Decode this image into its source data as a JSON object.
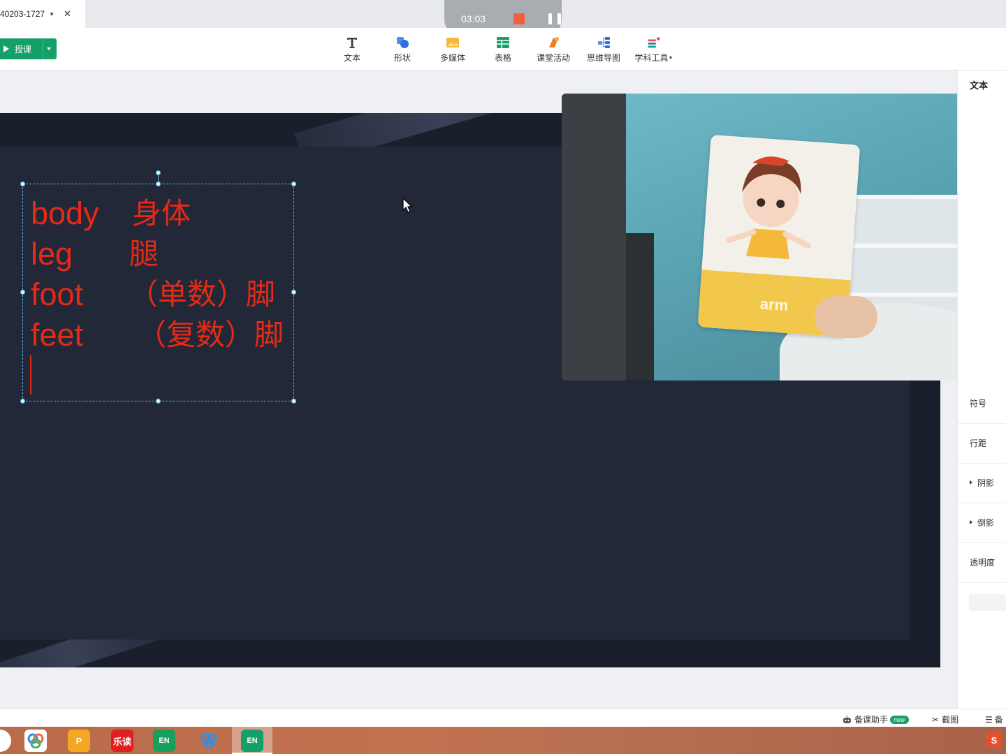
{
  "tab": {
    "title": "40203-1727",
    "close": "✕"
  },
  "recorder": {
    "time": "03:03"
  },
  "toolbar": {
    "teach_label": "授课",
    "tools": {
      "text": "文本",
      "shape": "形状",
      "media": "多媒体",
      "table": "表格",
      "activity": "课堂活动",
      "mindmap": "思维导图",
      "subject": "学科工具"
    }
  },
  "slide": {
    "lines": [
      {
        "en": "body",
        "zh": "身体"
      },
      {
        "en": "leg",
        "zh": "腿"
      },
      {
        "en": "foot",
        "zh": "（单数）脚"
      },
      {
        "en": "feet",
        "zh": "（复数）脚"
      }
    ],
    "text_color": "#e52a16",
    "background": "#222838"
  },
  "camera": {
    "card_word": "arm"
  },
  "props": {
    "title": "文本",
    "symbol": "符号",
    "line_spacing": "行距",
    "shadow": "阴影",
    "reflection": "倒影",
    "opacity": "透明度"
  },
  "statusbar": {
    "assistant": "备课助手",
    "assistant_badge": "new",
    "screenshot": "截图",
    "notes": "备"
  },
  "taskbar": {
    "apps": [
      "乐读",
      "EN",
      "EN"
    ],
    "tray": "S"
  },
  "colors": {
    "accent": "#15a06a",
    "record_stop": "#f1603e"
  }
}
